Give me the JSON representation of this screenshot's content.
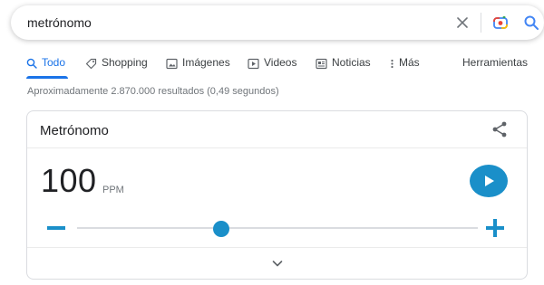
{
  "search": {
    "query": "metrónomo"
  },
  "tabs": [
    {
      "label": "Todo",
      "icon": "search-icon",
      "active": true
    },
    {
      "label": "Shopping",
      "icon": "tag-icon"
    },
    {
      "label": "Imágenes",
      "icon": "image-icon"
    },
    {
      "label": "Videos",
      "icon": "play-icon"
    },
    {
      "label": "Noticias",
      "icon": "newspaper-icon"
    },
    {
      "label": "Más",
      "icon": "more-vert-icon"
    }
  ],
  "tools_label": "Herramientas",
  "results_stats": "Aproximadamente 2.870.000 resultados (0,49 segundos)",
  "metronome": {
    "title": "Metrónomo",
    "bpm": "100",
    "unit": "PPM",
    "slider_fraction": 0.36
  },
  "colors": {
    "accent": "#1a8fc9",
    "active_tab": "#1a73e8",
    "text": "#202124",
    "muted": "#70757a"
  }
}
